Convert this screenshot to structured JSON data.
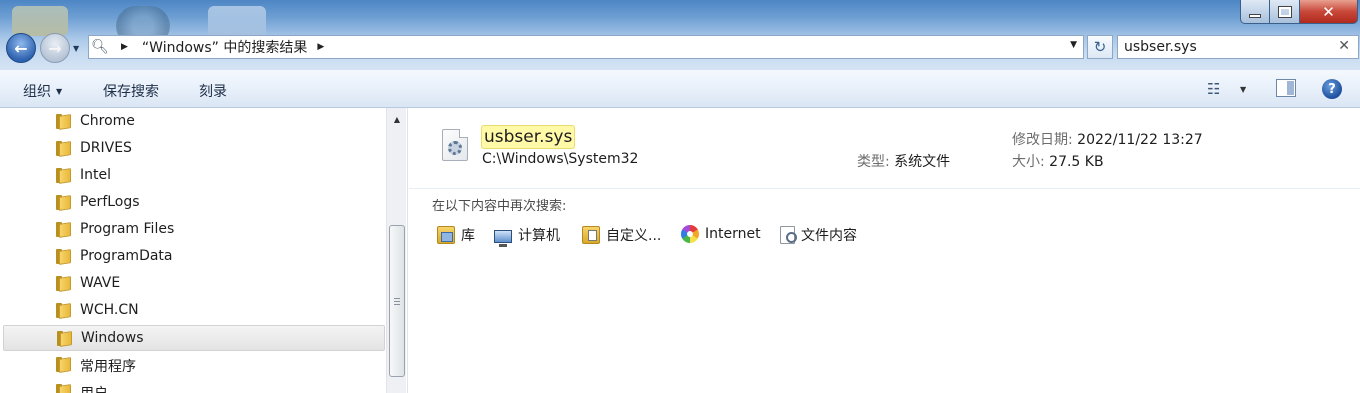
{
  "window": {
    "minimize_label": "",
    "maximize_label": "",
    "close_label": "✕"
  },
  "address": {
    "path_segment": "“Windows” 中的搜索结果",
    "search_query": "usbser.sys",
    "clear_label": "✕"
  },
  "toolbar": {
    "organize_label": "组织",
    "save_search_label": "保存搜索",
    "burn_label": "刻录",
    "help_label": "?"
  },
  "nav": {
    "items": [
      {
        "label": "Chrome"
      },
      {
        "label": "DRIVES"
      },
      {
        "label": "Intel"
      },
      {
        "label": "PerfLogs"
      },
      {
        "label": "Program Files"
      },
      {
        "label": "ProgramData"
      },
      {
        "label": "WAVE"
      },
      {
        "label": "WCH.CN"
      },
      {
        "label": "Windows",
        "selected": true
      },
      {
        "label": "常用程序"
      },
      {
        "label": "用户"
      }
    ]
  },
  "result": {
    "file_name": "usbser.sys",
    "path": "C:\\Windows\\System32",
    "type_label": "类型:",
    "type_value": "系统文件",
    "date_label": "修改日期:",
    "date_value": "2022/11/22 13:27",
    "size_label": "大小:",
    "size_value": "27.5 KB"
  },
  "search_again": {
    "label": "在以下内容中再次搜索:",
    "items": [
      {
        "label": "库",
        "icon": "library-icon"
      },
      {
        "label": "计算机",
        "icon": "computer-icon"
      },
      {
        "label": "自定义...",
        "icon": "custom-folder-icon"
      },
      {
        "label": "Internet",
        "icon": "internet-icon"
      },
      {
        "label": "文件内容",
        "icon": "file-contents-icon"
      }
    ]
  }
}
